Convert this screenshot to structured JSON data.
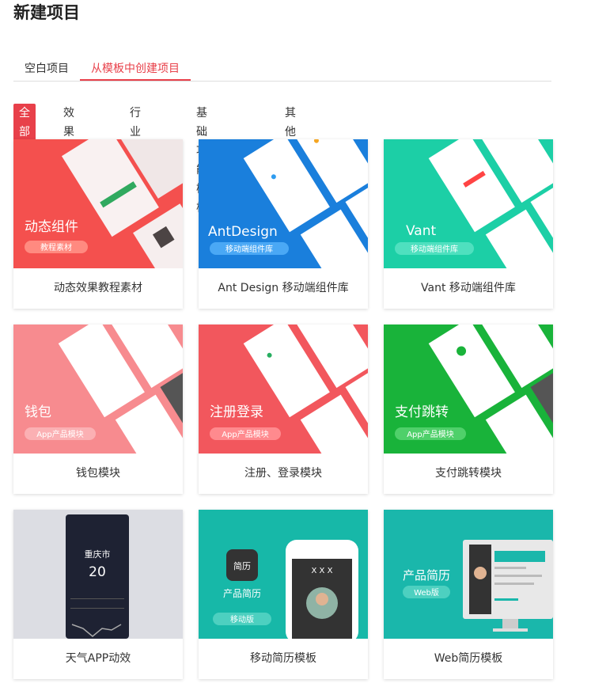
{
  "page": {
    "title": "新建项目"
  },
  "tabs": [
    {
      "label": "空白项目",
      "active": false
    },
    {
      "label": "从模板中创建项目",
      "active": true
    }
  ],
  "filters": [
    {
      "label": "全部",
      "active": true
    },
    {
      "label": "效果模板"
    },
    {
      "label": "行业模板"
    },
    {
      "label": "基础功能模板"
    },
    {
      "label": "其他"
    }
  ],
  "templates": [
    {
      "name": "动态效果教程素材",
      "thumb_title": "动态组件",
      "thumb_badge": "教程素材",
      "bg": "#f4504e",
      "bg2": "#ff8a80"
    },
    {
      "name": "Ant Design 移动端组件库",
      "thumb_title": "AntDesign",
      "thumb_badge": "移动端组件库",
      "bg": "#1a7fdc",
      "bg2": "#2e9cf0"
    },
    {
      "name": "Vant 移动端组件库",
      "thumb_title": "Vant",
      "thumb_badge": "移动端组件库",
      "bg": "#1ccfa6",
      "bg2": "#17b994"
    },
    {
      "name": "钱包模块",
      "thumb_title": "钱包",
      "thumb_badge": "App产品模块",
      "bg": "#f78b8f",
      "bg2": "#f26f75"
    },
    {
      "name": "注册、登录模块",
      "thumb_title": "注册登录",
      "thumb_badge": "App产品模块",
      "bg": "#f2575d",
      "bg2": "#ff7a7f"
    },
    {
      "name": "支付跳转模块",
      "thumb_title": "支付跳转",
      "thumb_badge": "App产品模块",
      "bg": "#19b33a",
      "bg2": "#11a22f"
    },
    {
      "name": "天气APP动效",
      "thumb_city": "重庆市",
      "thumb_temp": "20",
      "bg": "#dcdde3",
      "bg2": "#1e2233"
    },
    {
      "name": "移动简历模板",
      "thumb_title": "产品简历",
      "thumb_badge": "移动版",
      "thumb_icon_text": "简历",
      "thumb_phone_text": "X X X",
      "bg": "#17b8a8",
      "bg2": "#0fa698"
    },
    {
      "name": "Web简历模板",
      "thumb_title": "产品简历",
      "thumb_badge": "Web版",
      "bg": "#1ab7ab",
      "bg2": "#14a498"
    }
  ],
  "colors": {
    "accent": "#e8404a"
  }
}
